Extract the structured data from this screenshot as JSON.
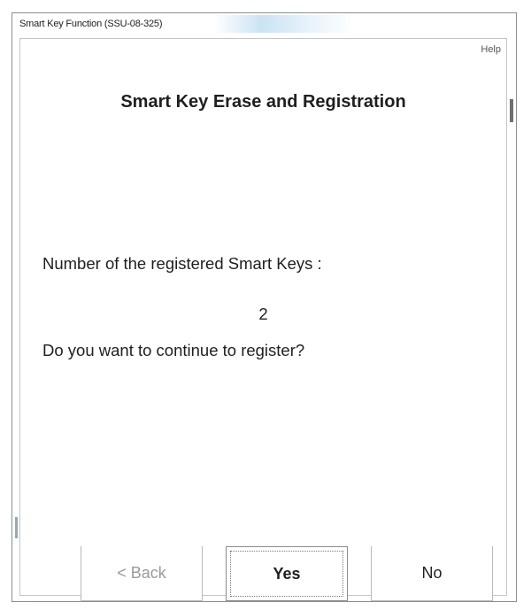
{
  "window": {
    "title": "Smart Key Function (SSU-08-325)"
  },
  "menu": {
    "help_label": "Help"
  },
  "content": {
    "heading": "Smart Key Erase and Registration",
    "registered_label": "Number of the registered Smart Keys :",
    "registered_count": "2",
    "question": "Do you want to continue to register?"
  },
  "buttons": {
    "back_label": "< Back",
    "yes_label": "Yes",
    "no_label": "No"
  },
  "colors": {
    "text": "#1f1f1f",
    "disabled_text": "#9a9a9a",
    "border": "#b9b9b9"
  }
}
